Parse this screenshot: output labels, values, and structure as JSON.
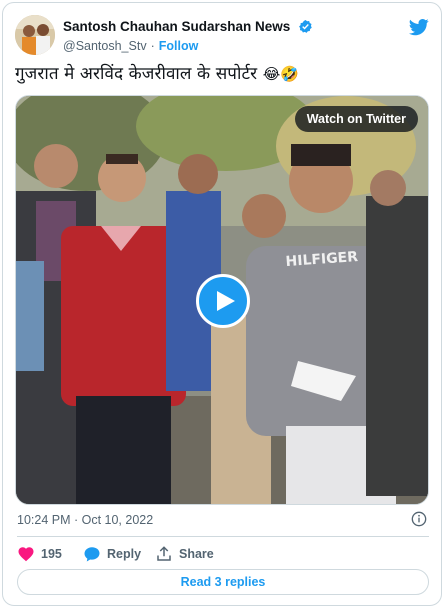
{
  "author": {
    "display_name": "Santosh Chauhan Sudarshan News",
    "handle": "@Santosh_Stv",
    "separator": "·",
    "follow_label": "Follow"
  },
  "tweet": {
    "text": "गुजरात मे अरविंद केजरीवाल के सपोर्टर",
    "emojis": "😂🤣"
  },
  "media": {
    "watch_label": "Watch on Twitter",
    "shirt_text": "HILFIGER"
  },
  "meta": {
    "timestamp": "10:24 PM · Oct 10, 2022"
  },
  "actions": {
    "like_count": "195",
    "reply_label": "Reply",
    "share_label": "Share"
  },
  "read_replies_label": "Read 3 replies",
  "colors": {
    "accent": "#1d9bf0",
    "like": "#f91880",
    "muted": "#536471"
  }
}
